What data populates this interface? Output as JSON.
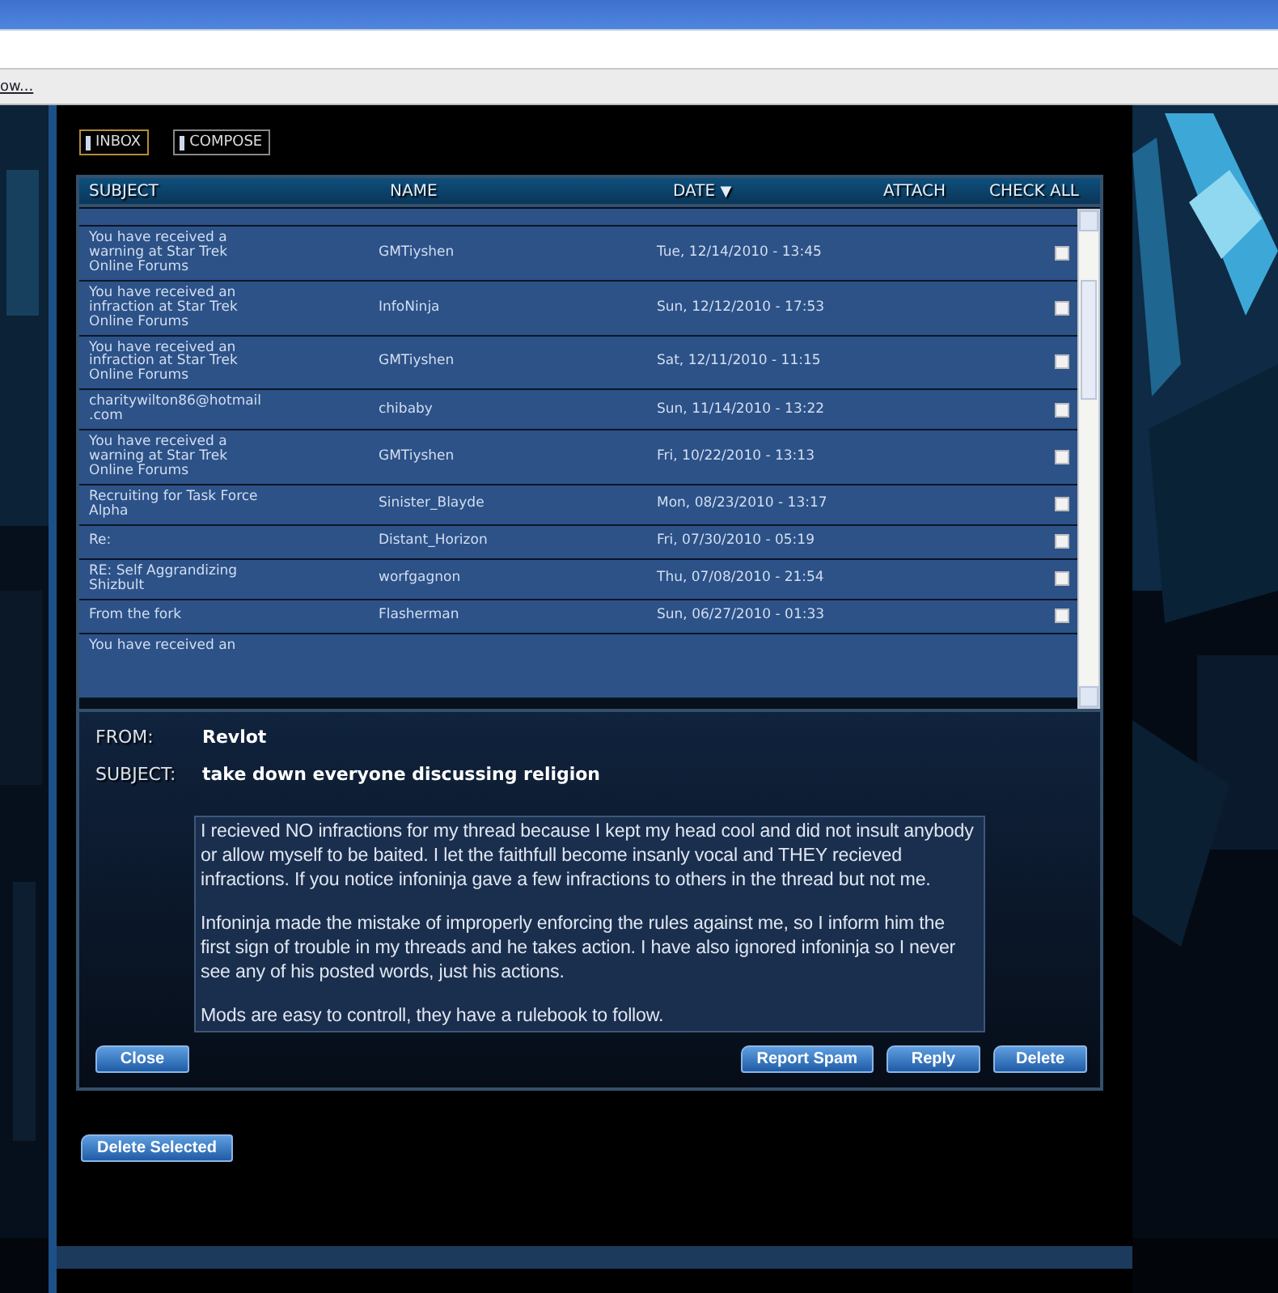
{
  "browser": {
    "link_text": "ow..."
  },
  "tabs": [
    {
      "label": "INBOX",
      "selected": true
    },
    {
      "label": "COMPOSE",
      "selected": false
    }
  ],
  "table": {
    "columns": [
      {
        "label": "SUBJECT"
      },
      {
        "label": "NAME"
      },
      {
        "label": "DATE",
        "sort": "▼"
      },
      {
        "label": "ATTACH"
      },
      {
        "label": "CHECK ALL"
      }
    ],
    "rows": [
      {
        "subject": "You have received a warning at Star Trek Online Forums",
        "name": "GMTiyshen",
        "date": "Tue, 12/14/2010 - 13:45",
        "checked": false
      },
      {
        "subject": "You have received an infraction at Star Trek Online Forums",
        "name": "InfoNinja",
        "date": "Sun, 12/12/2010 - 17:53",
        "checked": false
      },
      {
        "subject": "You have received an infraction at Star Trek Online Forums",
        "name": "GMTiyshen",
        "date": "Sat, 12/11/2010 - 11:15",
        "checked": false
      },
      {
        "subject": "charitywilton86@hotmail.com",
        "name": "chibaby",
        "date": "Sun, 11/14/2010 - 13:22",
        "checked": false
      },
      {
        "subject": "You have received a warning at Star Trek Online Forums",
        "name": "GMTiyshen",
        "date": "Fri, 10/22/2010 - 13:13",
        "checked": false
      },
      {
        "subject": "Recruiting for Task Force Alpha",
        "name": "Sinister_Blayde",
        "date": "Mon, 08/23/2010 - 13:17",
        "checked": false
      },
      {
        "subject": "Re:",
        "name": "Distant_Horizon",
        "date": "Fri, 07/30/2010 - 05:19",
        "checked": false
      },
      {
        "subject": "RE: Self Aggrandizing Shizbult",
        "name": "worfgagnon",
        "date": "Thu, 07/08/2010 - 21:54",
        "checked": false
      },
      {
        "subject": "From the fork",
        "name": "Flasherman",
        "date": "Sun, 06/27/2010 - 01:33",
        "checked": false
      },
      {
        "subject": "You have received an"
      }
    ]
  },
  "message": {
    "from_label": "FROM:",
    "from": "Revlot",
    "subject_label": "SUBJECT:",
    "subject": "take down everyone discussing religion",
    "body": [
      "I recieved NO infractions for my thread because I kept my head cool and did not insult anybody or allow myself to be baited. I let the faithfull become insanly vocal and THEY recieved infractions. If you notice infoninja gave a few infractions to others in the thread but not me.",
      "Infoninja made the mistake of improperly enforcing the rules against me, so I inform him the first sign of trouble in my threads and he takes action. I have also ignored infoninja so I never see any of his posted words, just his actions.",
      "Mods are easy to controll, they have a rulebook to follow."
    ],
    "left_buttons": [
      "Close"
    ],
    "right_buttons": [
      "Report Spam",
      "Reply",
      "Delete"
    ]
  },
  "footer_buttons": [
    "Delete Selected"
  ]
}
